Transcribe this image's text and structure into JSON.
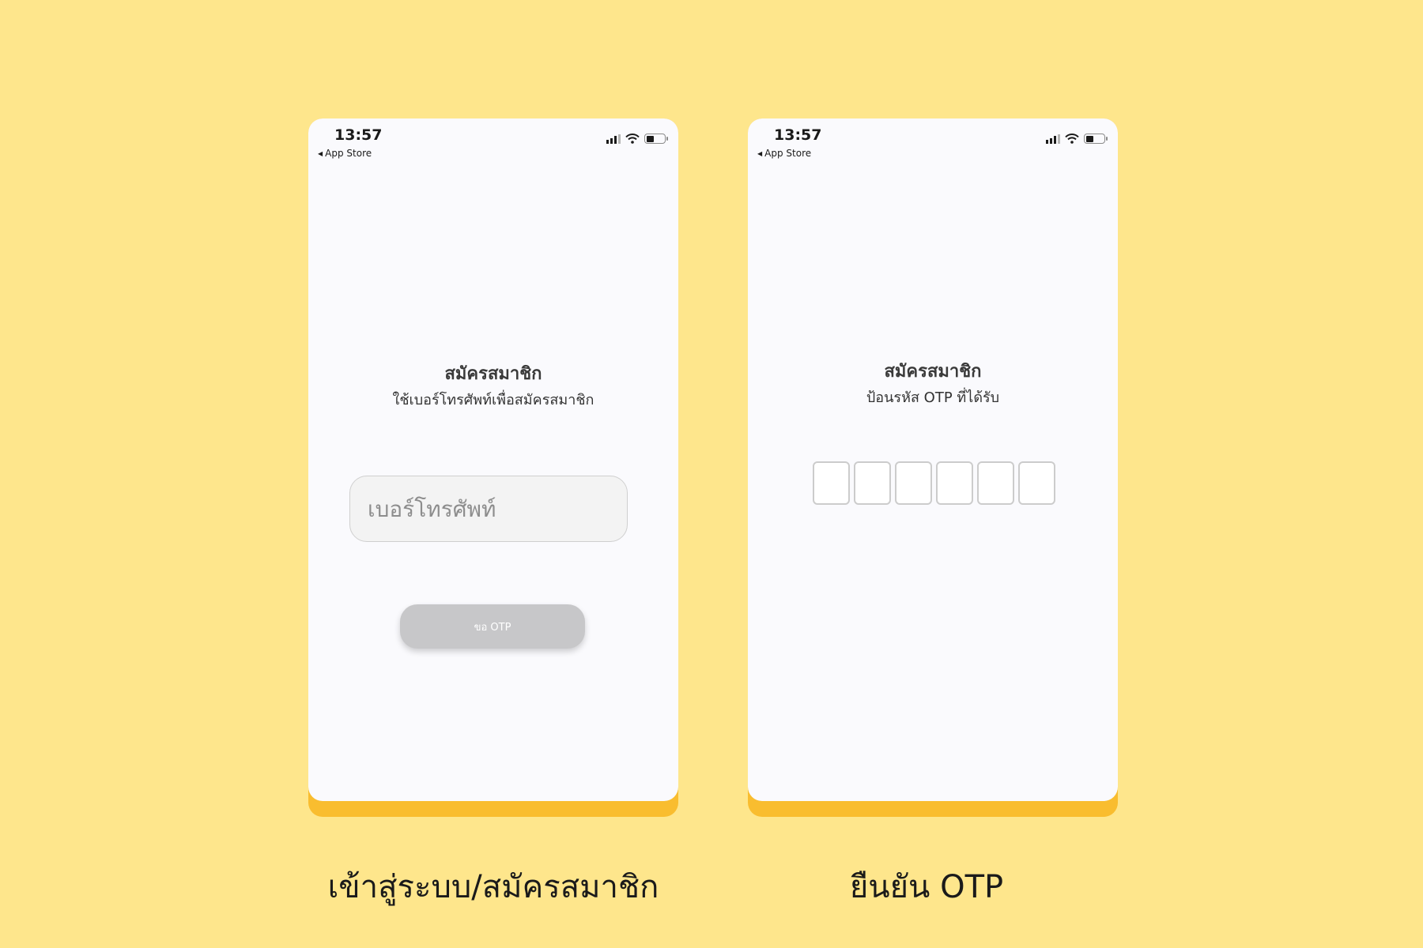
{
  "colors": {
    "background": "#fee68c",
    "phone_shadow": "#f9bd2f",
    "screen": "#fafafd",
    "button_disabled": "#c7c7c9"
  },
  "screens": [
    {
      "status_time": "13:57",
      "back_label": "App Store",
      "title": "สมัครสมาชิก",
      "subtitle": "ใช้เบอร์โทรศัพท์เพื่อสมัครสมาชิก",
      "phone_input": {
        "value": "",
        "placeholder": "เบอร์โทรศัพท์"
      },
      "request_otp_button": "ขอ OTP",
      "caption": "เข้าสู่ระบบ/สมัครสมาชิก"
    },
    {
      "status_time": "13:57",
      "back_label": "App Store",
      "title": "สมัครสมาชิก",
      "subtitle": "ป้อนรหัส OTP ที่ได้รับ",
      "otp_digits": [
        "",
        "",
        "",
        "",
        "",
        ""
      ],
      "caption": "ยืนยัน OTP"
    }
  ],
  "icons": [
    "back-arrow-icon",
    "signal-icon",
    "wifi-icon",
    "battery-icon"
  ]
}
